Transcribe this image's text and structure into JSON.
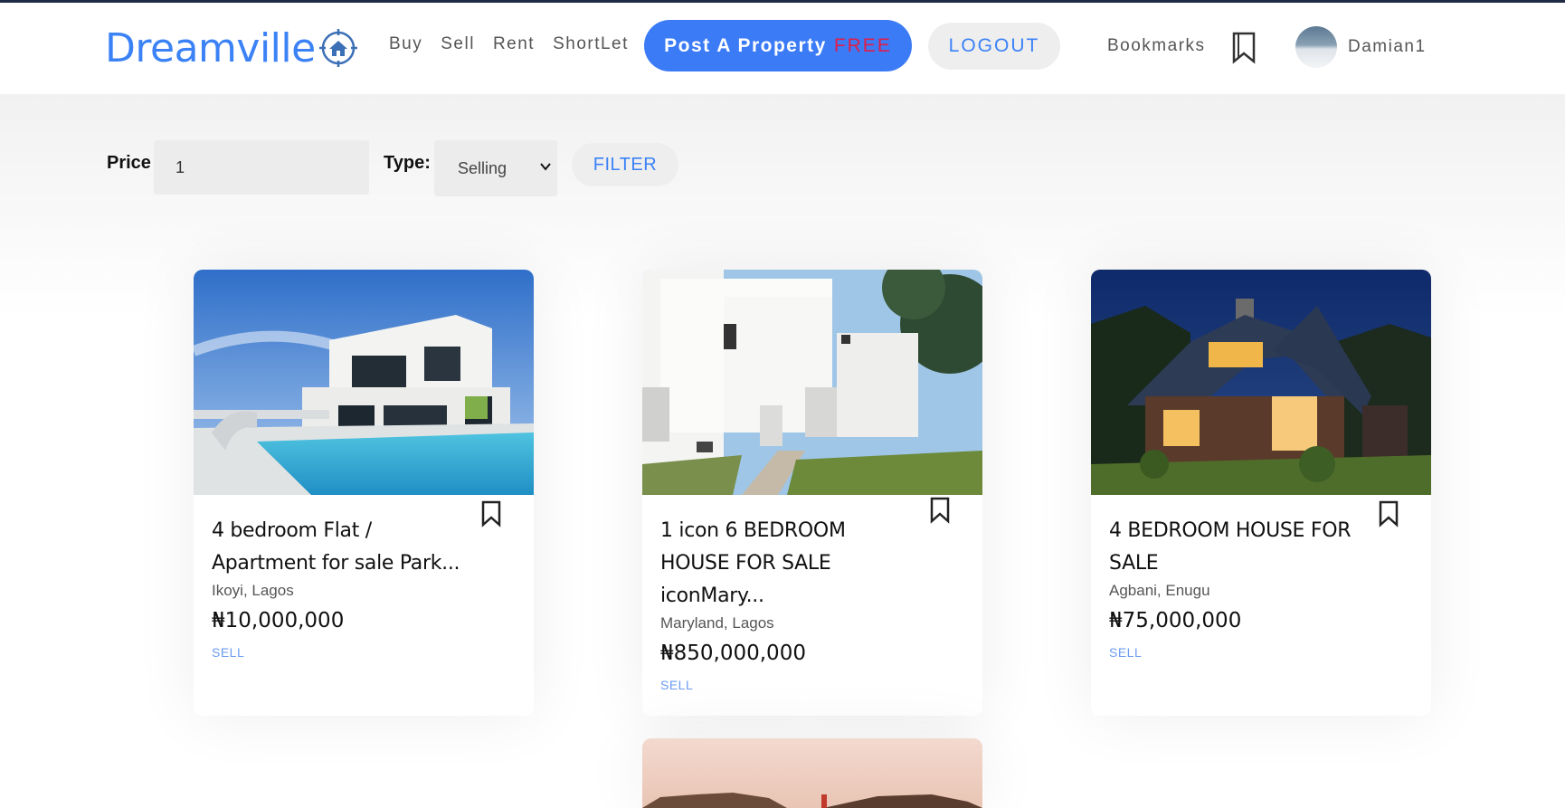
{
  "header": {
    "logo_text": "Dreamville",
    "nav": [
      "Buy",
      "Sell",
      "Rent",
      "ShortLet"
    ],
    "post_label": "Post A Property",
    "post_free": "FREE",
    "logout_label": "LOGOUT",
    "bookmarks_label": "Bookmarks",
    "username": "Damian1"
  },
  "filter": {
    "price_label": "Price",
    "price_value": "1",
    "type_label": "Type:",
    "type_value": "Selling",
    "button_label": "FILTER"
  },
  "listings": [
    {
      "title": "4 bedroom Flat / Apartment for sale Park...",
      "location": "Ikoyi, Lagos",
      "price": "₦10,000,000",
      "tag": "SELL"
    },
    {
      "title": "1 icon 6 BEDROOM HOUSE FOR SALE iconMary...",
      "location": "Maryland, Lagos",
      "price": "₦850,000,000",
      "tag": "SELL"
    },
    {
      "title": "4 BEDROOM HOUSE FOR SALE",
      "location": "Agbani, Enugu",
      "price": "₦75,000,000",
      "tag": "SELL"
    }
  ],
  "colors": {
    "brand": "#3b82f6",
    "free": "#e11d48",
    "tag": "#6b9cf0"
  },
  "icons": {
    "logo": "house-target-icon",
    "bookmark": "bookmark-icon",
    "select": "chevron-down-icon"
  }
}
